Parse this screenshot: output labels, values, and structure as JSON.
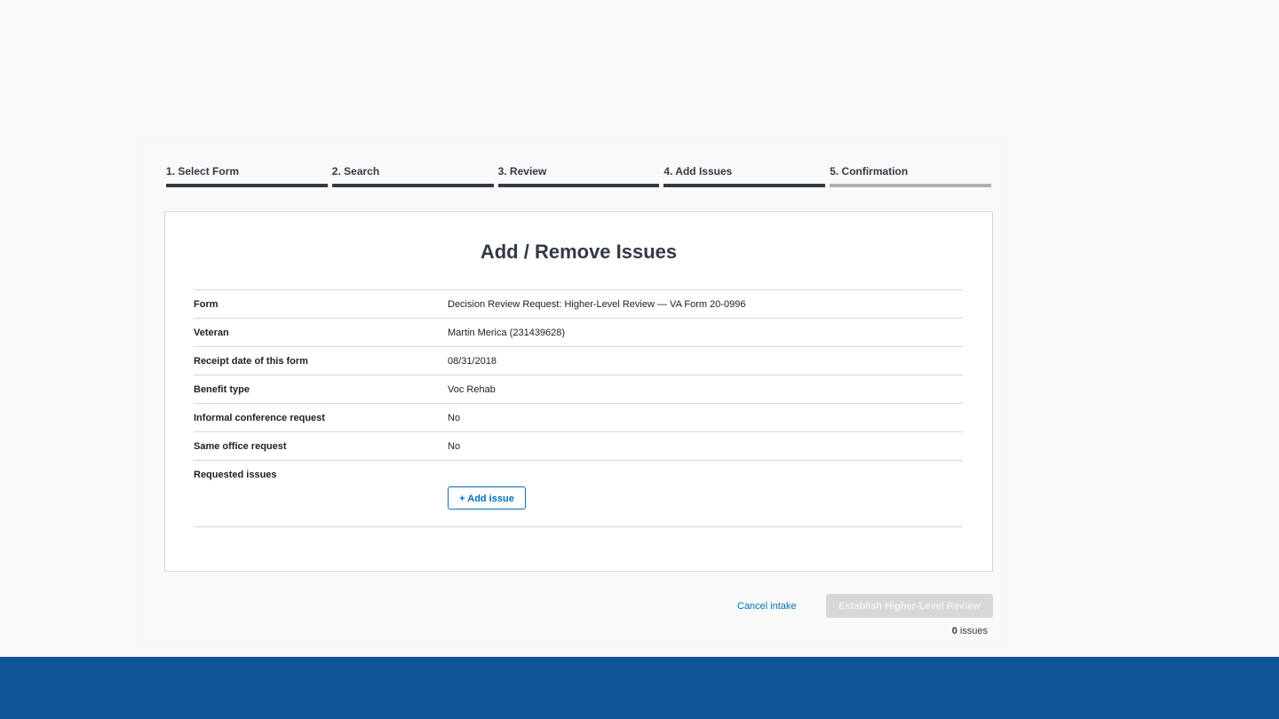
{
  "stepper": {
    "steps": [
      {
        "label": "1. Select Form"
      },
      {
        "label": "2. Search"
      },
      {
        "label": "3. Review"
      },
      {
        "label": "4. Add Issues"
      },
      {
        "label": "5. Confirmation"
      }
    ],
    "completed_steps": 4
  },
  "card": {
    "title": "Add / Remove Issues",
    "rows": [
      {
        "label": "Form",
        "value": "Decision Review Request: Higher-Level Review — VA Form 20-0996"
      },
      {
        "label": "Veteran",
        "value": "Martin Merica (231439628)"
      },
      {
        "label": "Receipt date of this form",
        "value": "08/31/2018"
      },
      {
        "label": "Benefit type",
        "value": "Voc Rehab"
      },
      {
        "label": "Informal conference request",
        "value": "No"
      },
      {
        "label": "Same office request",
        "value": "No"
      }
    ],
    "requested_issues_label": "Requested issues",
    "add_issue_label": "+ Add issue"
  },
  "actions": {
    "cancel_label": "Cancel intake",
    "establish_label": "Establish Higher-Level Review",
    "issue_count": "0",
    "issue_count_suffix": "issues"
  },
  "colors": {
    "link": "#0071bb",
    "footer": "#0f5597",
    "step_active": "#323a45",
    "step_inactive": "#aeb0b5",
    "button_disabled": "#d6d7d9"
  }
}
